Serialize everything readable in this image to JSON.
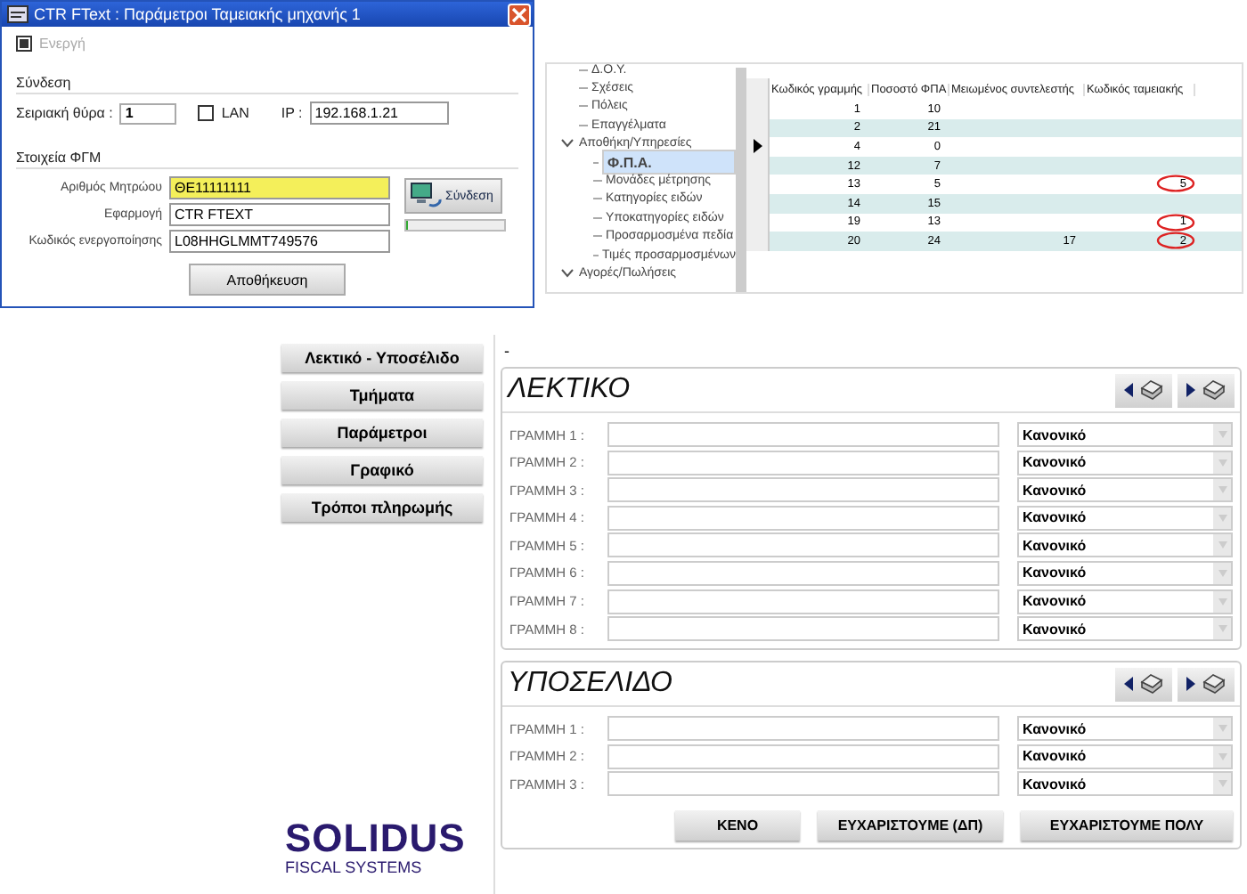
{
  "dialog": {
    "title": "CTR FText : Παράμετροι Ταμειακής μηχανής 1",
    "active": {
      "label": "Ενεργή",
      "checked": true,
      "disabled": true
    },
    "connection": {
      "heading": "Σύνδεση",
      "port_label": "Σειριακή θύρα :",
      "port": "1",
      "lan": {
        "label": "LAN",
        "checked": false
      },
      "ip_label": "IP :",
      "ip": "192.168.1.21"
    },
    "fiscal": {
      "heading": "Στοιχεία ΦΓΜ",
      "fields": [
        {
          "label": "Αριθμός Μητρώου",
          "value": "ΘΕ11111111",
          "highlighted": true
        },
        {
          "label": "Εφαρμογή",
          "value": "CTR FTEXT",
          "highlighted": false
        },
        {
          "label": "Κωδικός ενεργοποίησης",
          "value": "L08HHGLMMT749576",
          "highlighted": false
        }
      ]
    },
    "connect_button": "Σύνδεση",
    "connect_progress": {
      "level": 0
    },
    "save_button": "Αποθήκευση"
  },
  "tree": [
    {
      "label": "Δ.Ο.Υ.",
      "selected": false
    },
    {
      "label": "Σχέσεις",
      "selected": false
    },
    {
      "label": "Πόλεις",
      "selected": false
    },
    {
      "label": "Επαγγέλματα",
      "selected": false
    },
    {
      "label": "Αποθήκη/Υπηρεσίες",
      "selected": false,
      "expanded": true,
      "children": [
        {
          "label": "Φ.Π.Α.",
          "selected": true
        },
        {
          "label": "Μονάδες μέτρησης",
          "selected": false
        },
        {
          "label": "Κατηγορίες ειδών",
          "selected": false
        },
        {
          "label": "Υποκατηγορίες ειδών",
          "selected": false
        },
        {
          "label": "Προσαρμοσμένα πεδία",
          "selected": false
        },
        {
          "label": "Τιμές προσαρμοσμένων",
          "selected": false
        }
      ]
    },
    {
      "label": "Αγορές/Πωλήσεις",
      "selected": false,
      "expanded": true
    }
  ],
  "grid": {
    "columns": [
      "Κωδικός γραμμής",
      "Ποσοστό ΦΠΑ",
      "Μειωμένος συντελεστής",
      "Κωδικός ταμειακής"
    ],
    "rows": [
      {
        "cells": [
          "1",
          "10",
          "",
          ""
        ],
        "current": false,
        "circled": false
      },
      {
        "cells": [
          "2",
          "21",
          "",
          ""
        ],
        "current": false,
        "circled": false
      },
      {
        "cells": [
          "4",
          "0",
          "",
          ""
        ],
        "current": true,
        "circled": false
      },
      {
        "cells": [
          "12",
          "7",
          "",
          ""
        ],
        "current": false,
        "circled": false
      },
      {
        "cells": [
          "13",
          "5",
          "",
          "5"
        ],
        "current": false,
        "circled": true
      },
      {
        "cells": [
          "14",
          "15",
          "",
          ""
        ],
        "current": false,
        "circled": false
      },
      {
        "cells": [
          "19",
          "13",
          "",
          "1"
        ],
        "current": false,
        "circled": true
      },
      {
        "cells": [
          "20",
          "24",
          "17",
          "2"
        ],
        "current": false,
        "circled": true
      }
    ]
  },
  "menu": [
    "Λεκτικό - Υποσέλιδο",
    "Τμήματα",
    "Παράμετροι",
    "Γραφικό",
    "Τρόποι πληρωμής"
  ],
  "dash": "-",
  "sections": [
    {
      "title": "ΛΕΚΤΙΚΟ",
      "lines": [
        {
          "label": "ΓΡΑΜΜΗ 1 :",
          "style": "Κανονικό"
        },
        {
          "label": "ΓΡΑΜΜΗ 2 :",
          "style": "Κανονικό"
        },
        {
          "label": "ΓΡΑΜΜΗ 3 :",
          "style": "Κανονικό"
        },
        {
          "label": "ΓΡΑΜΜΗ 4 :",
          "style": "Κανονικό"
        },
        {
          "label": "ΓΡΑΜΜΗ 5 :",
          "style": "Κανονικό"
        },
        {
          "label": "ΓΡΑΜΜΗ 6 :",
          "style": "Κανονικό"
        },
        {
          "label": "ΓΡΑΜΜΗ 7 :",
          "style": "Κανονικό"
        },
        {
          "label": "ΓΡΑΜΜΗ 8 :",
          "style": "Κανονικό"
        }
      ]
    },
    {
      "title": "ΥΠΟΣΕΛΙΔΟ",
      "lines": [
        {
          "label": "ΓΡΑΜΜΗ 1 :",
          "style": "Κανονικό"
        },
        {
          "label": "ΓΡΑΜΜΗ 2 :",
          "style": "Κανονικό"
        },
        {
          "label": "ΓΡΑΜΜΗ 3 :",
          "style": "Κανονικό"
        }
      ]
    }
  ],
  "buttons": [
    "ΚΕΝΟ",
    "ΕΥΧΑΡΙΣΤΟΥΜΕ (ΔΠ)",
    "ΕΥΧΑΡΙΣΤΟΥΜΕ ΠΟΛΥ"
  ],
  "logo": {
    "name": "SOLIDUS",
    "tagline": "FISCAL SYSTEMS"
  }
}
